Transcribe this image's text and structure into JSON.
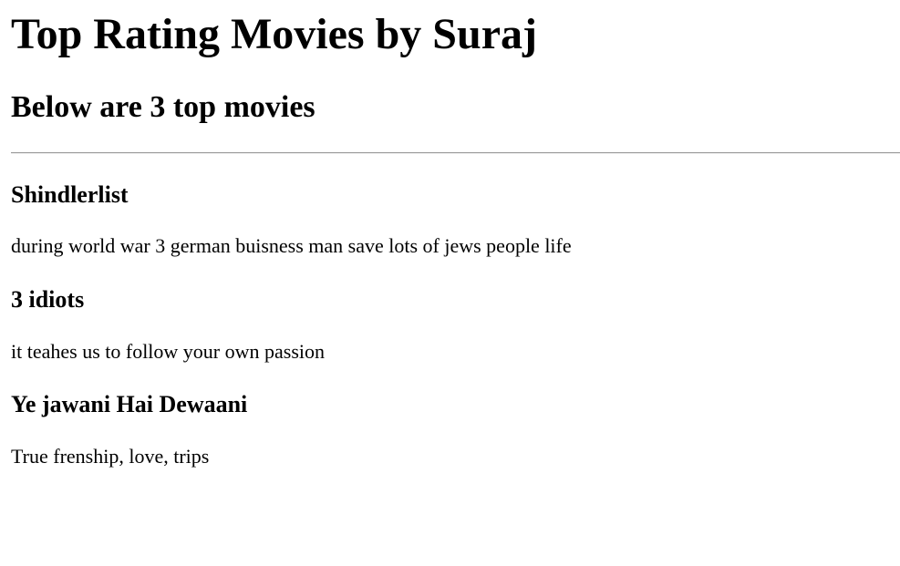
{
  "page": {
    "title": "Top Rating Movies by Suraj",
    "subtitle": "Below are 3 top movies"
  },
  "movies": [
    {
      "title": "Shindlerlist",
      "description": "during world war 3 german buisness man save lots of jews people life"
    },
    {
      "title": "3 idiots",
      "description": "it teahes us to follow your own passion"
    },
    {
      "title": "Ye jawani Hai Dewaani",
      "description": "True frenship, love, trips"
    }
  ]
}
